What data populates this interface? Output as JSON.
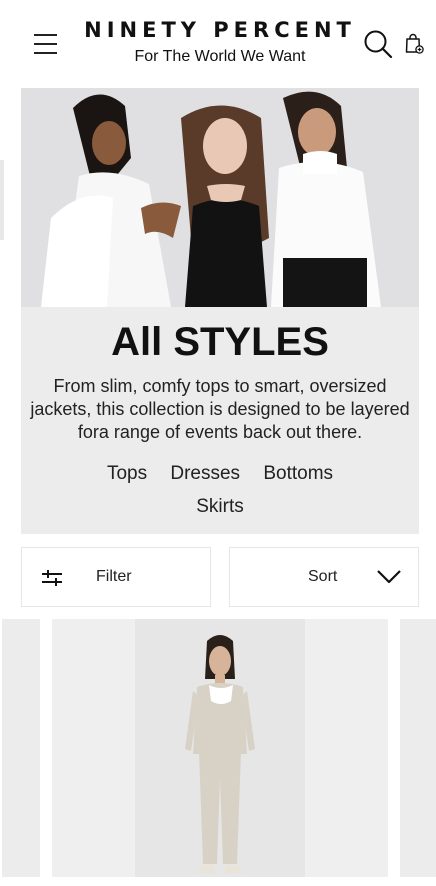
{
  "header": {
    "brand_name": "NINETY PERCENT",
    "tagline": "For The World We Want",
    "icons": {
      "menu": "hamburger-menu-icon",
      "search": "search-icon",
      "bag": "shopping-bag-icon"
    }
  },
  "hero": {
    "title": "All STYLES",
    "description": "From slim, comfy tops to smart, oversized jackets, this collection is designed to be layered fora range of events back out there.",
    "categories": [
      "Tops",
      "Dresses",
      "Bottoms",
      "Skirts"
    ]
  },
  "toolbar": {
    "filter_label": "Filter",
    "sort_label": "Sort",
    "icons": {
      "filter": "sliders-icon",
      "sort": "chevron-down-icon"
    }
  },
  "colors": {
    "background": "#ffffff",
    "panel": "#ececec",
    "text": "#111111",
    "border": "#e6e6e6"
  }
}
